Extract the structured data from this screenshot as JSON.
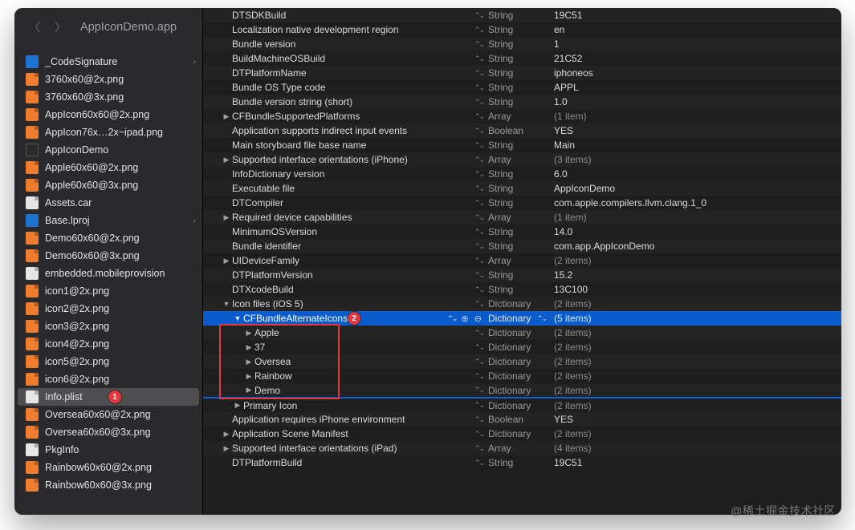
{
  "window": {
    "title": "AppIconDemo.app"
  },
  "badges": {
    "sidebar": "1",
    "plist": "2"
  },
  "watermark": "@稀土掘金技术社区",
  "sidebar": {
    "items": [
      {
        "name": "_CodeSignature",
        "icon": "folder",
        "hasChildren": true
      },
      {
        "name": "3760x60@2x.png",
        "icon": "png"
      },
      {
        "name": "3760x60@3x.png",
        "icon": "png"
      },
      {
        "name": "AppIcon60x60@2x.png",
        "icon": "png"
      },
      {
        "name": "AppIcon76x…2x~ipad.png",
        "icon": "png"
      },
      {
        "name": "AppIconDemo",
        "icon": "exec"
      },
      {
        "name": "Apple60x60@2x.png",
        "icon": "png"
      },
      {
        "name": "Apple60x60@3x.png",
        "icon": "png"
      },
      {
        "name": "Assets.car",
        "icon": "file"
      },
      {
        "name": "Base.lproj",
        "icon": "folder",
        "hasChildren": true
      },
      {
        "name": "Demo60x60@2x.png",
        "icon": "png"
      },
      {
        "name": "Demo60x60@3x.png",
        "icon": "png"
      },
      {
        "name": "embedded.mobileprovision",
        "icon": "file"
      },
      {
        "name": "icon1@2x.png",
        "icon": "png"
      },
      {
        "name": "icon2@2x.png",
        "icon": "png"
      },
      {
        "name": "icon3@2x.png",
        "icon": "png"
      },
      {
        "name": "icon4@2x.png",
        "icon": "png"
      },
      {
        "name": "icon5@2x.png",
        "icon": "png"
      },
      {
        "name": "icon6@2x.png",
        "icon": "png"
      },
      {
        "name": "Info.plist",
        "icon": "plist",
        "selected": true
      },
      {
        "name": "Oversea60x60@2x.png",
        "icon": "png"
      },
      {
        "name": "Oversea60x60@3x.png",
        "icon": "png"
      },
      {
        "name": "PkgInfo",
        "icon": "file"
      },
      {
        "name": "Rainbow60x60@2x.png",
        "icon": "png"
      },
      {
        "name": "Rainbow60x60@3x.png",
        "icon": "png"
      }
    ]
  },
  "plist": {
    "rows": [
      {
        "d": 1,
        "tw": "",
        "key": "DTSDKBuild",
        "type": "String",
        "val": "19C51"
      },
      {
        "d": 1,
        "tw": "",
        "key": "Localization native development region",
        "type": "String",
        "val": "en"
      },
      {
        "d": 1,
        "tw": "",
        "key": "Bundle version",
        "type": "String",
        "val": "1"
      },
      {
        "d": 1,
        "tw": "",
        "key": "BuildMachineOSBuild",
        "type": "String",
        "val": "21C52"
      },
      {
        "d": 1,
        "tw": "",
        "key": "DTPlatformName",
        "type": "String",
        "val": "iphoneos"
      },
      {
        "d": 1,
        "tw": "",
        "key": "Bundle OS Type code",
        "type": "String",
        "val": "APPL"
      },
      {
        "d": 1,
        "tw": "",
        "key": "Bundle version string (short)",
        "type": "String",
        "val": "1.0"
      },
      {
        "d": 1,
        "tw": "r",
        "key": "CFBundleSupportedPlatforms",
        "type": "Array",
        "val": "(1 item)",
        "muted": true
      },
      {
        "d": 1,
        "tw": "",
        "key": "Application supports indirect input events",
        "type": "Boolean",
        "val": "YES"
      },
      {
        "d": 1,
        "tw": "",
        "key": "Main storyboard file base name",
        "type": "String",
        "val": "Main"
      },
      {
        "d": 1,
        "tw": "r",
        "key": "Supported interface orientations (iPhone)",
        "type": "Array",
        "val": "(3 items)",
        "muted": true
      },
      {
        "d": 1,
        "tw": "",
        "key": "InfoDictionary version",
        "type": "String",
        "val": "6.0"
      },
      {
        "d": 1,
        "tw": "",
        "key": "Executable file",
        "type": "String",
        "val": "AppIconDemo"
      },
      {
        "d": 1,
        "tw": "",
        "key": "DTCompiler",
        "type": "String",
        "val": "com.apple.compilers.llvm.clang.1_0"
      },
      {
        "d": 1,
        "tw": "r",
        "key": "Required device capabilities",
        "type": "Array",
        "val": "(1 item)",
        "muted": true
      },
      {
        "d": 1,
        "tw": "",
        "key": "MinimumOSVersion",
        "type": "String",
        "val": "14.0"
      },
      {
        "d": 1,
        "tw": "",
        "key": "Bundle identifier",
        "type": "String",
        "val": "com.app.AppIconDemo"
      },
      {
        "d": 1,
        "tw": "r",
        "key": "UIDeviceFamily",
        "type": "Array",
        "val": "(2 items)",
        "muted": true
      },
      {
        "d": 1,
        "tw": "",
        "key": "DTPlatformVersion",
        "type": "String",
        "val": "15.2"
      },
      {
        "d": 1,
        "tw": "",
        "key": "DTXcodeBuild",
        "type": "String",
        "val": "13C100"
      },
      {
        "d": 1,
        "tw": "d",
        "key": "Icon files (iOS 5)",
        "type": "Dictionary",
        "val": "(2 items)",
        "muted": true
      },
      {
        "d": 2,
        "tw": "d",
        "key": "CFBundleAlternateIcons",
        "type": "Dictionary",
        "val": "(5 items)",
        "muted": true,
        "selected": true,
        "controls": true
      },
      {
        "d": 3,
        "tw": "r",
        "key": "Apple",
        "type": "Dictionary",
        "val": "(2 items)",
        "muted": true
      },
      {
        "d": 3,
        "tw": "r",
        "key": "37",
        "type": "Dictionary",
        "val": "(2 items)",
        "muted": true
      },
      {
        "d": 3,
        "tw": "r",
        "key": "Oversea",
        "type": "Dictionary",
        "val": "(2 items)",
        "muted": true
      },
      {
        "d": 3,
        "tw": "r",
        "key": "Rainbow",
        "type": "Dictionary",
        "val": "(2 items)",
        "muted": true
      },
      {
        "d": 3,
        "tw": "r",
        "key": "Demo",
        "type": "Dictionary",
        "val": "(2 items)",
        "muted": true
      },
      {
        "d": 2,
        "tw": "r",
        "key": "Primary Icon",
        "type": "Dictionary",
        "val": "(2 items)",
        "muted": true
      },
      {
        "d": 1,
        "tw": "",
        "key": "Application requires iPhone environment",
        "type": "Boolean",
        "val": "YES"
      },
      {
        "d": 1,
        "tw": "r",
        "key": "Application Scene Manifest",
        "type": "Dictionary",
        "val": "(2 items)",
        "muted": true
      },
      {
        "d": 1,
        "tw": "r",
        "key": "Supported interface orientations (iPad)",
        "type": "Array",
        "val": "(4 items)",
        "muted": true
      },
      {
        "d": 1,
        "tw": "",
        "key": "DTPlatformBuild",
        "type": "String",
        "val": "19C51"
      }
    ]
  }
}
